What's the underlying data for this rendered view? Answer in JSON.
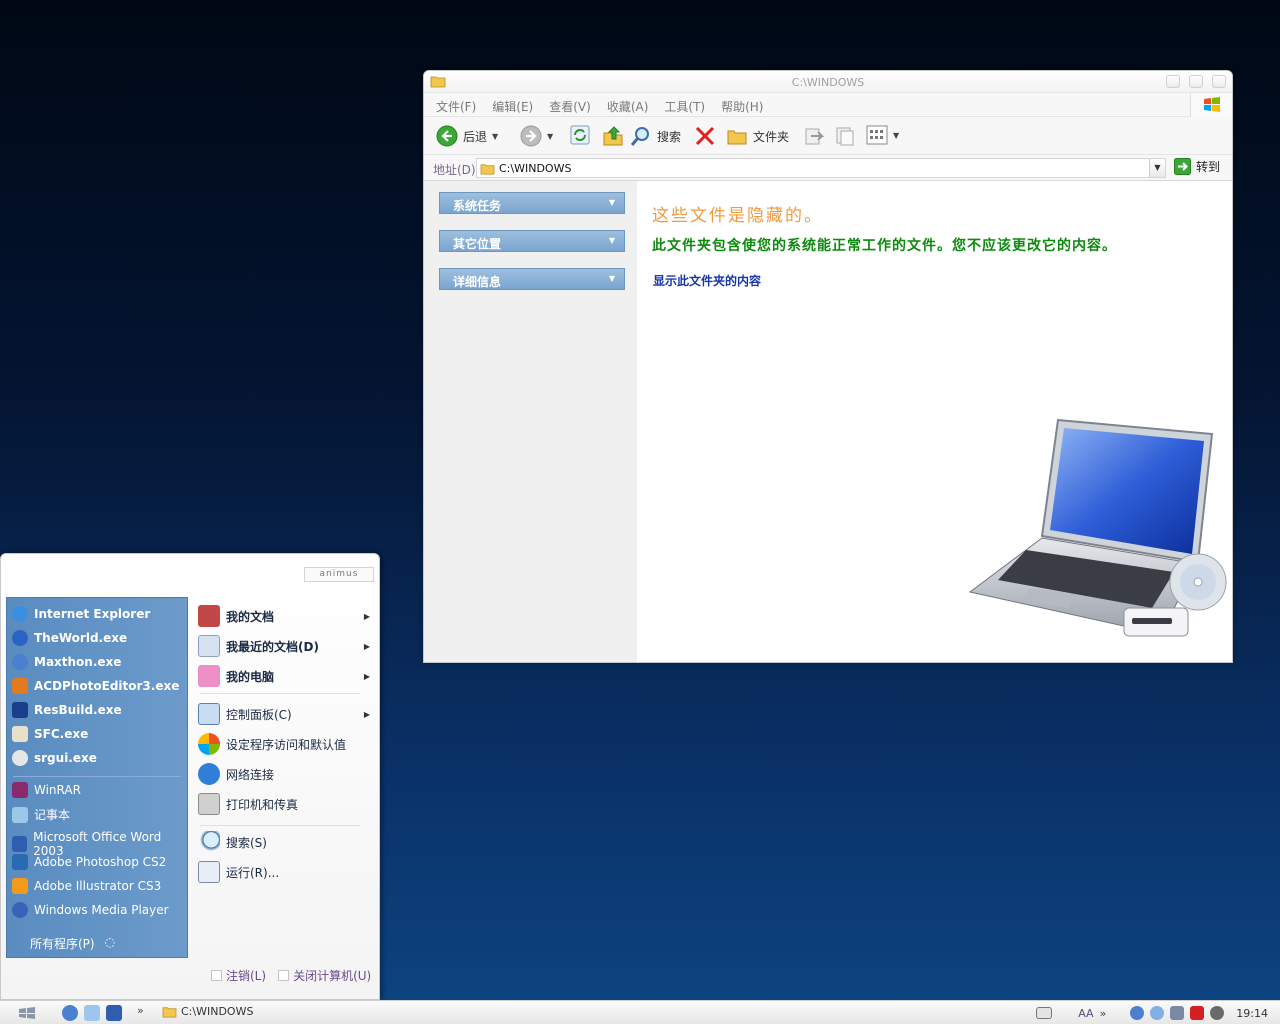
{
  "window": {
    "title": "C:\\WINDOWS",
    "menu": [
      "文件(F)",
      "编辑(E)",
      "查看(V)",
      "收藏(A)",
      "工具(T)",
      "帮助(H)"
    ],
    "toolbar": {
      "back": "后退",
      "search": "搜索",
      "folders": "文件夹"
    },
    "address": {
      "label": "地址(D)",
      "value": "C:\\WINDOWS",
      "go": "转到"
    },
    "tasks": [
      "系统任务",
      "其它位置",
      "详细信息"
    ],
    "content": {
      "heading": "这些文件是隐藏的。",
      "message": "此文件夹包含使您的系统能正常工作的文件。您不应该更改它的内容。",
      "link": "显示此文件夹的内容"
    }
  },
  "start_menu": {
    "user": "animus",
    "pinned": [
      "Internet Explorer",
      "TheWorld.exe",
      "Maxthon.exe",
      "ACDPhotoEditor3.exe",
      "ResBuild.exe",
      "SFC.exe",
      "srgui.exe"
    ],
    "recent": [
      "WinRAR",
      "记事本",
      "Microsoft Office Word 2003",
      "Adobe Photoshop CS2",
      "Adobe Illustrator CS3",
      "Windows Media Player"
    ],
    "all_programs": "所有程序(P)",
    "places": [
      "我的文档",
      "我最近的文档(D)",
      "我的电脑"
    ],
    "system": [
      "控制面板(C)",
      "设定程序访问和默认值",
      "网络连接",
      "打印机和传真"
    ],
    "tools": [
      "搜索(S)",
      "运行(R)..."
    ],
    "logoff": "注销(L)",
    "shutdown": "关闭计算机(U)"
  },
  "taskbar": {
    "task": "C:\\WINDOWS",
    "chevron": "»",
    "aa": "AA",
    "clock": "19:14"
  },
  "colors": {
    "heading": "#f09a3e",
    "message": "#0e8a10",
    "link": "#1838a8",
    "start_left": "#5a8cc0",
    "task_header": "#7aa5cf"
  }
}
